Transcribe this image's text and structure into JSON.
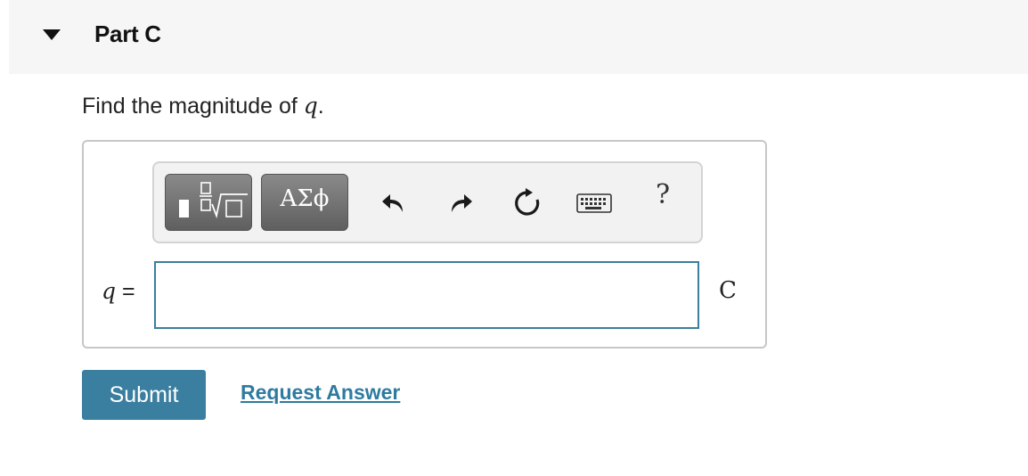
{
  "part": {
    "title": "Part C",
    "toggle_icon": "caret-down-icon"
  },
  "question": {
    "prompt_text": "Find the magnitude of ",
    "prompt_var": "q",
    "prompt_end": "."
  },
  "toolbar": {
    "templates_icon": "math-templates-icon",
    "greek_label": "ΑΣϕ",
    "undo_icon": "undo-arrow-icon",
    "redo_icon": "redo-arrow-icon",
    "reset_icon": "reset-icon",
    "keyboard_icon": "keyboard-icon",
    "help_label": "?"
  },
  "answer": {
    "variable": "q",
    "equals": " =",
    "value": "",
    "unit": "C"
  },
  "actions": {
    "submit_label": "Submit",
    "request_answer_label": "Request Answer"
  },
  "colors": {
    "header_bg": "#f6f6f6",
    "accent": "#3a7ea0",
    "link": "#2e7ba0",
    "input_border": "#3a7f9b"
  }
}
